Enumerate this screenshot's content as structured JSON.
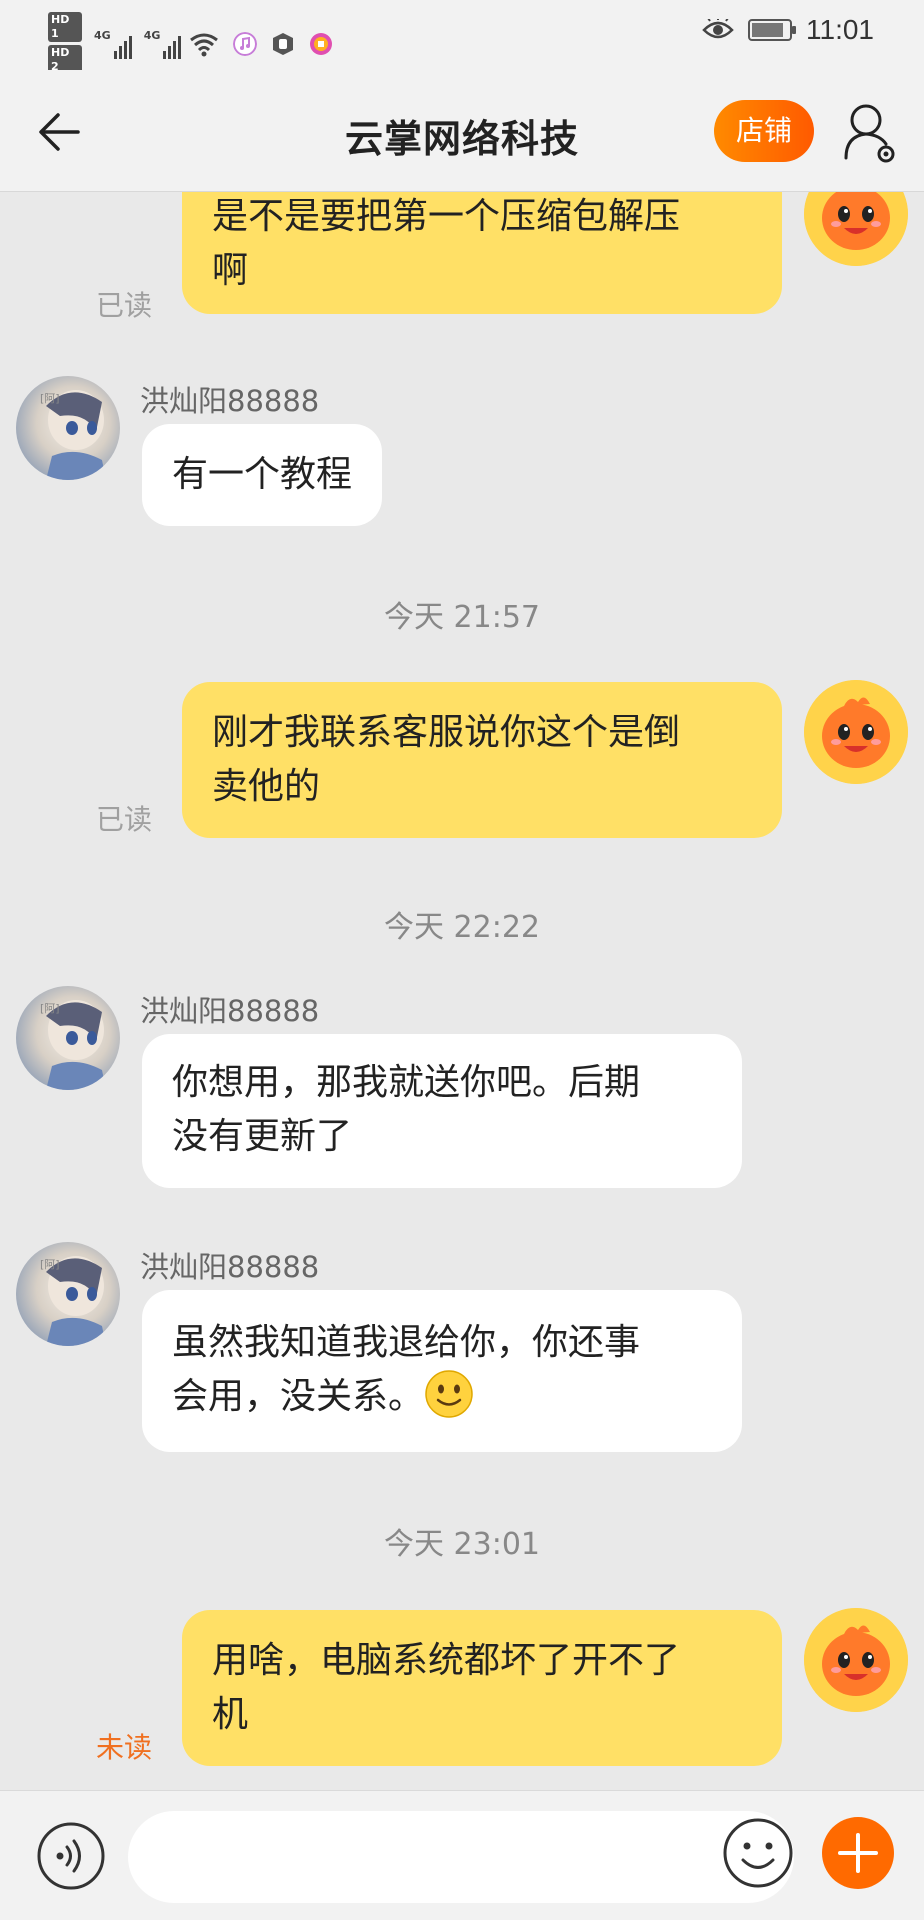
{
  "status_bar": {
    "sim1_label": "HD 1",
    "sim2_label": "HD 2",
    "network1": "4G",
    "network2": "4G",
    "time": "11:01",
    "battery_level": 0.85
  },
  "header": {
    "title": "云掌网络科技",
    "shop_label": "店铺"
  },
  "messages": [
    {
      "side": "me",
      "text_lines": [
        "是不是要把第一个压缩包解压",
        "啊"
      ],
      "status": "已读"
    },
    {
      "side": "them",
      "sender": "洪灿阳88888",
      "text_lines": [
        "有一个教程"
      ]
    },
    {
      "type": "time",
      "text": "今天  21:57"
    },
    {
      "side": "me",
      "text_lines": [
        "刚才我联系客服说你这个是倒",
        "卖他的"
      ],
      "status": "已读"
    },
    {
      "type": "time",
      "text": "今天  22:22"
    },
    {
      "side": "them",
      "sender": "洪灿阳88888",
      "text_lines": [
        "你想用，那我就送你吧。后期",
        "没有更新了"
      ]
    },
    {
      "side": "them",
      "sender": "洪灿阳88888",
      "text_lines": [
        "虽然我知道我退给你，你还事",
        "会用，没关系。"
      ],
      "emoji": "slightly-smiling-face"
    },
    {
      "type": "time",
      "text": "今天  23:01"
    },
    {
      "side": "me",
      "text_lines": [
        "用啥，电脑系统都坏了开不了",
        "机"
      ],
      "status": "未读"
    }
  ],
  "input": {
    "value": "",
    "placeholder": ""
  },
  "colors": {
    "my_bubble": "#ffe066",
    "their_bubble": "#ffffff",
    "background": "#e9e9e9",
    "accent_orange": "#ff6a00",
    "unread": "#f07020"
  },
  "icons": [
    "back-arrow-icon",
    "user-settings-icon",
    "voice-icon",
    "emoji-icon",
    "plus-icon",
    "mascot-avatar",
    "contact-avatar"
  ]
}
